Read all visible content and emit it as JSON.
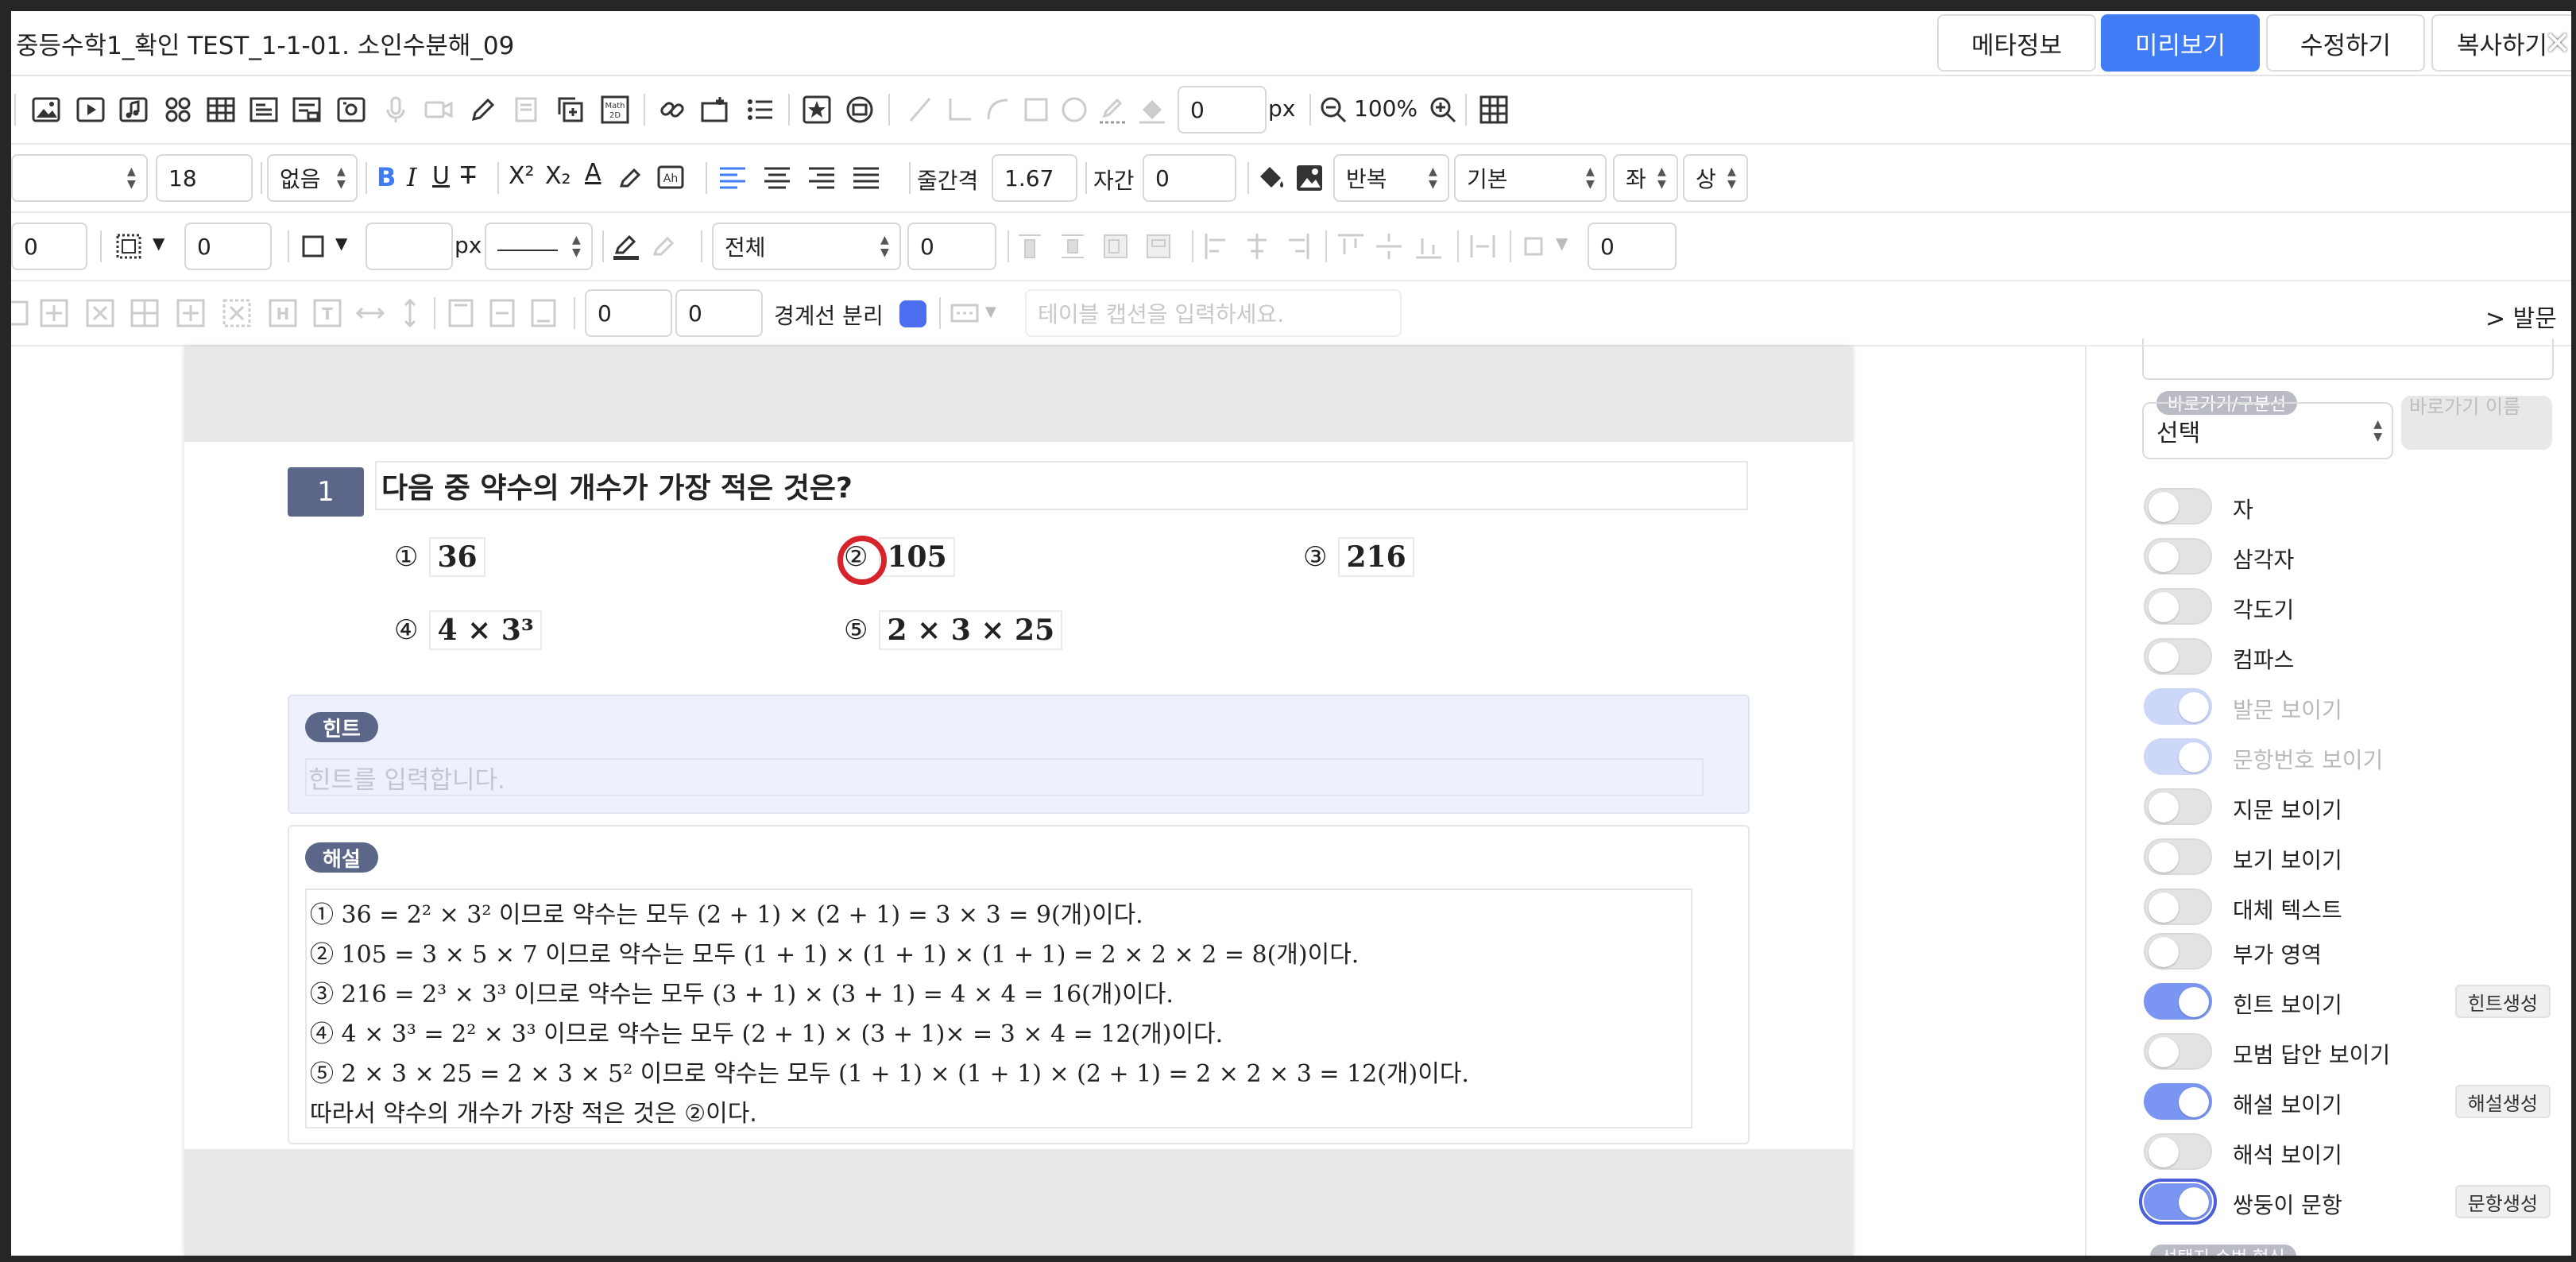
{
  "window": {
    "title": "중등수학1_확인 TEST_1-1-01. 소인수분해_09",
    "close_glyph": "✕"
  },
  "top_buttons": [
    {
      "label": "메타정보",
      "active": false
    },
    {
      "label": "미리보기",
      "active": true
    },
    {
      "label": "수정하기",
      "active": false
    },
    {
      "label": "복사하기",
      "active": false
    }
  ],
  "toolbar1": {
    "icons": [
      "image-icon",
      "video-icon",
      "audio-icon",
      "shapes-icon",
      "table-icon",
      "text-box-icon",
      "form-icon",
      "widget-icon",
      "mic-icon",
      "camera-icon",
      "pencil-icon",
      "note-icon",
      "copy-icon",
      "math-icon",
      "link-icon",
      "insert-icon",
      "list-icon",
      "star-box-icon",
      "image-search-icon",
      "line-icon",
      "corner-icon",
      "curve-icon",
      "square-icon",
      "circle-icon",
      "stroke-color-icon",
      "fill-icon",
      "zoom-out-icon",
      "zoom-in-icon",
      "grid-icon"
    ],
    "px_value": "0",
    "px_unit": "px",
    "zoom": "100%"
  },
  "toolbar2": {
    "font_size": "18",
    "style_select": "없음",
    "line_spacing_label": "줄간격",
    "line_spacing_value": "1.67",
    "letter_spacing_label": "자간",
    "letter_spacing_value": "0",
    "repeat_select": "반복",
    "base_select": "기본",
    "align_h": "좌",
    "align_v": "상"
  },
  "toolbar3": {
    "first_value": "0",
    "border_width": "0",
    "px_unit": "px",
    "scope_select": "전체",
    "scope_value": "0",
    "last_value": "0"
  },
  "toolbar4": {
    "val1": "0",
    "val2": "0",
    "border_sep_label": "경계선 분리",
    "caption_placeholder": "테이블 캡션을 입력하세요.",
    "right_link": "> 발문"
  },
  "question": {
    "number": "1",
    "text": "다음 중 약수의 개수가 가장 적은 것은?",
    "choices": [
      {
        "num": "①",
        "value": "36"
      },
      {
        "num": "②",
        "value": "105"
      },
      {
        "num": "③",
        "value": "216"
      },
      {
        "num": "④",
        "value": "4 × 3³"
      },
      {
        "num": "⑤",
        "value": "2 × 3 × 25"
      }
    ]
  },
  "hint": {
    "label": "힌트",
    "placeholder": "힌트를 입력합니다."
  },
  "solution": {
    "label": "해설",
    "lines": [
      "① 36 = 2² × 3² 이므로 약수는 모두 (2 + 1) × (2 + 1) = 3 × 3 = 9(개)이다.",
      "② 105 = 3 × 5 × 7 이므로 약수는 모두 (1 + 1) × (1 + 1) × (1 + 1) = 2 × 2 × 2 = 8(개)이다.",
      "③ 216 = 2³ × 3³ 이므로 약수는 모두 (3 + 1) × (3 + 1) = 4 × 4 = 16(개)이다.",
      "④ 4 × 3³ = 2² × 3³ 이므로 약수는 모두 (2 + 1) × (3 + 1)× = 3 × 4 = 12(개)이다.",
      "⑤ 2 × 3 × 25 = 2 × 3 × 5² 이므로 약수는 모두 (1 + 1) × (1 + 1) × (2 + 1) = 2 × 2 × 3 = 12(개)이다.",
      "따라서 약수의 개수가 가장 적은 것은 ②이다."
    ]
  },
  "right_panel": {
    "shortcut_label": "바로가기/구분선",
    "shortcut_select": "선택",
    "shortcut_name_btn": "바로가기 이름",
    "toggles": [
      {
        "label": "자",
        "on": false
      },
      {
        "label": "삼각자",
        "on": false
      },
      {
        "label": "각도기",
        "on": false
      },
      {
        "label": "컴파스",
        "on": false
      },
      {
        "label": "발문 보이기",
        "on": true,
        "disabled": true
      },
      {
        "label": "문항번호 보이기",
        "on": true,
        "disabled": true
      },
      {
        "label": "지문 보이기",
        "on": false
      },
      {
        "label": "보기 보이기",
        "on": false
      },
      {
        "label": "대체 텍스트",
        "on": false
      },
      {
        "label": "부가 영역",
        "on": false
      },
      {
        "label": "힌트 보이기",
        "on": true,
        "button": "힌트생성"
      },
      {
        "label": "모범 답안 보이기",
        "on": false
      },
      {
        "label": "해설 보이기",
        "on": true,
        "button": "해설생성"
      },
      {
        "label": "해석 보이기",
        "on": false
      },
      {
        "label": "쌍둥이 문항",
        "on": true,
        "focused": true,
        "button": "문항생성"
      }
    ],
    "bottom_label": "선택지 순번 형식"
  },
  "colors": {
    "accent": "#3f7cf6",
    "label_pill": "#5b6688",
    "answer_circle": "#d8232a",
    "toggle_on": "#7b95f2"
  }
}
